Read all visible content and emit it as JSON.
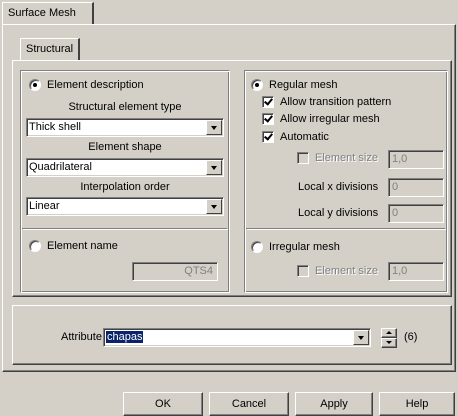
{
  "tabs": {
    "outer": "Surface Mesh",
    "inner": "Structural"
  },
  "element_description": {
    "radio_label": "Element description",
    "structural_type_label": "Structural element type",
    "structural_type_value": "Thick shell",
    "shape_label": "Element shape",
    "shape_value": "Quadrilateral",
    "interpolation_label": "Interpolation order",
    "interpolation_value": "Linear"
  },
  "element_name": {
    "radio_label": "Element name",
    "value": "QTS4"
  },
  "regular_mesh": {
    "radio_label": "Regular mesh",
    "allow_transition_label": "Allow transition pattern",
    "allow_irregular_label": "Allow irregular mesh",
    "automatic_label": "Automatic",
    "element_size_label": "Element size",
    "element_size_value": "1,0",
    "local_x_label": "Local x divisions",
    "local_x_value": "0",
    "local_y_label": "Local y divisions",
    "local_y_value": "0"
  },
  "irregular_mesh": {
    "radio_label": "Irregular mesh",
    "element_size_label": "Element size",
    "element_size_value": "1,0"
  },
  "attribute": {
    "label": "Attribute",
    "value": "chapas",
    "count": "(6)"
  },
  "buttons": {
    "ok": "OK",
    "cancel": "Cancel",
    "apply": "Apply",
    "help": "Help"
  },
  "colors": {
    "face": "#d4d0c8",
    "selection": "#0a246a",
    "field": "#ffffff"
  }
}
